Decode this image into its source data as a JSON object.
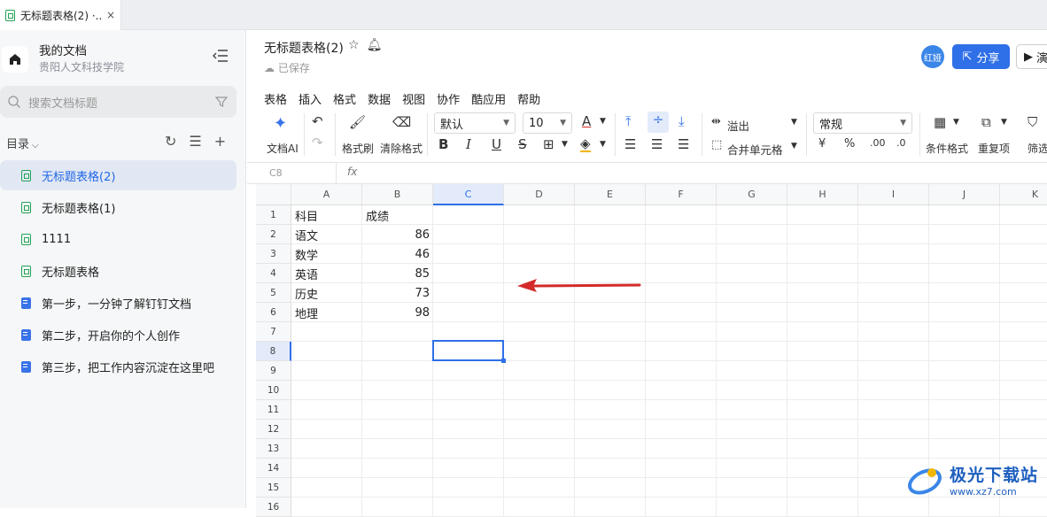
{
  "tab": {
    "title": "无标题表格(2) ·...",
    "close": "×"
  },
  "sidebar": {
    "workspace_name": "我的文档",
    "workspace_org": "贵阳人文科技学院",
    "search_placeholder": "搜索文档标题",
    "directory_label": "目录",
    "items": [
      {
        "label": "无标题表格(2)",
        "type": "sheet",
        "active": true
      },
      {
        "label": "无标题表格(1)",
        "type": "sheet",
        "active": false
      },
      {
        "label": "1111",
        "type": "sheet",
        "active": false
      },
      {
        "label": "无标题表格",
        "type": "sheet",
        "active": false
      },
      {
        "label": "第一步，一分钟了解钉钉文档",
        "type": "doc",
        "active": false
      },
      {
        "label": "第二步，开启你的个人创作",
        "type": "doc",
        "active": false
      },
      {
        "label": "第三步，把工作内容沉淀在这里吧",
        "type": "doc",
        "active": false
      }
    ]
  },
  "header": {
    "title": "无标题表格(2)",
    "saved": "已保存",
    "avatar": "红娅",
    "share_label": "分享",
    "present_label": "演"
  },
  "menu": [
    "表格",
    "插入",
    "格式",
    "数据",
    "视图",
    "协作",
    "酷应用",
    "帮助"
  ],
  "toolbar": {
    "ai_label": "文档AI",
    "painter_label": "格式刷",
    "clear_label": "清除格式",
    "font": "默认",
    "font_size": "10",
    "overflow_label": "溢出",
    "merge_label": "合并单元格",
    "number_format": "常规",
    "conditional_label": "条件格式",
    "duplicate_label": "重复项",
    "filter_label": "筛选",
    "bold": "B",
    "italic": "I",
    "underline": "U",
    "strike": "S",
    "currency": "¥",
    "percent": "%"
  },
  "formula_bar": {
    "cell_ref": "C8",
    "fx": "fx"
  },
  "grid": {
    "columns": [
      "A",
      "B",
      "C",
      "D",
      "E",
      "F",
      "G",
      "H",
      "I",
      "J",
      "K"
    ],
    "rows": [
      "1",
      "2",
      "3",
      "4",
      "5",
      "6",
      "7",
      "8",
      "9",
      "10",
      "11",
      "12",
      "13",
      "14",
      "15",
      "16"
    ],
    "selected_cell": "C8",
    "data": [
      {
        "a": "科目",
        "b": "成绩"
      },
      {
        "a": "语文",
        "b": "86"
      },
      {
        "a": "数学",
        "b": "46"
      },
      {
        "a": "英语",
        "b": "85"
      },
      {
        "a": "历史",
        "b": "73"
      },
      {
        "a": "地理",
        "b": "98"
      }
    ]
  },
  "watermark": {
    "text": "极光下载站",
    "url": "www.xz7.com"
  },
  "colors": {
    "accent": "#2f6fe8",
    "sheet_green": "#22a355",
    "arrow_red": "#d42a2a",
    "active_item_bg": "#e2e8f3"
  }
}
